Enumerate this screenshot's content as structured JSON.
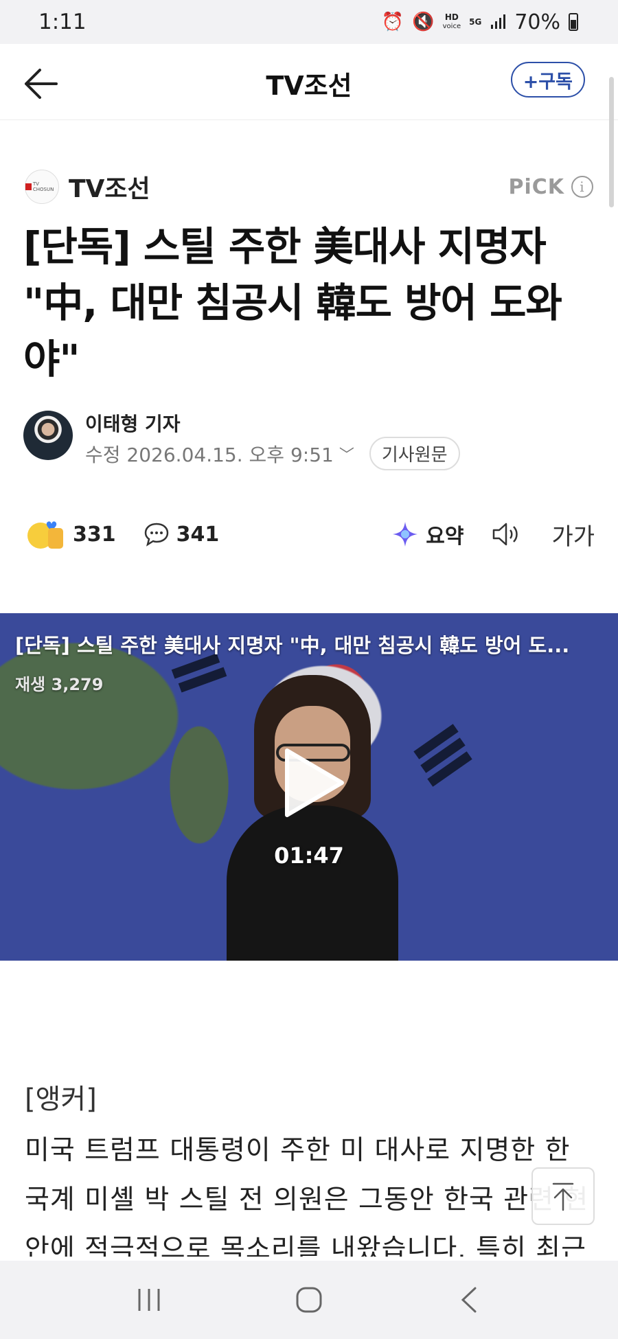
{
  "status_bar": {
    "time": "1:11",
    "hd_label": "HD",
    "voice_label": "voice",
    "network_label": "5G",
    "battery": "70%"
  },
  "top_bar": {
    "title": "TV조선",
    "subscribe_label": "+구독"
  },
  "article": {
    "press_name": "TV조선",
    "press_logo_text": "TV CHOSUN",
    "pick_label": "PiCK",
    "headline": "[단독] 스틸 주한 美대사 지명자 \"中, 대만 침공시 韓도 방어 도와야\"",
    "reporter": "이태형 기자",
    "date_line": "수정 2026.04.15. 오후 9:51",
    "source_button": "기사원문",
    "reactions_count": "331",
    "comments_count": "341",
    "summary_label": "요약",
    "font_size_label": "가가"
  },
  "video": {
    "title": "[단독] 스틸 주한 美대사 지명자 \"中, 대만 침공시 韓도 방어 도...",
    "views": "재생 3,279",
    "duration": "01:47"
  },
  "body": {
    "anchor_tag": "[앵커]",
    "text": "미국 트럼프 대통령이 주한 미 대사로 지명한 한국계 미셸 박 스틸 전 의원은 그동안 한국 관련 현안에 적극적으로 목소리를 내왔습니다. 특히 최근 인"
  },
  "icons": {
    "back": "arrow-left-icon",
    "info": "info-icon",
    "reaction": "reaction-emoji-icon",
    "comment": "speech-bubble-icon",
    "summary": "sparkle-icon",
    "tts": "speaker-icon",
    "play": "play-icon",
    "scroll_top": "arrow-up-icon",
    "recents": "recent-apps-icon",
    "home": "home-icon",
    "nav_back": "chevron-left-icon"
  },
  "colors": {
    "accent": "#2c4fa8",
    "status_bar_bg": "#f2f2f4",
    "text_primary": "#111111",
    "text_muted": "#777777"
  }
}
